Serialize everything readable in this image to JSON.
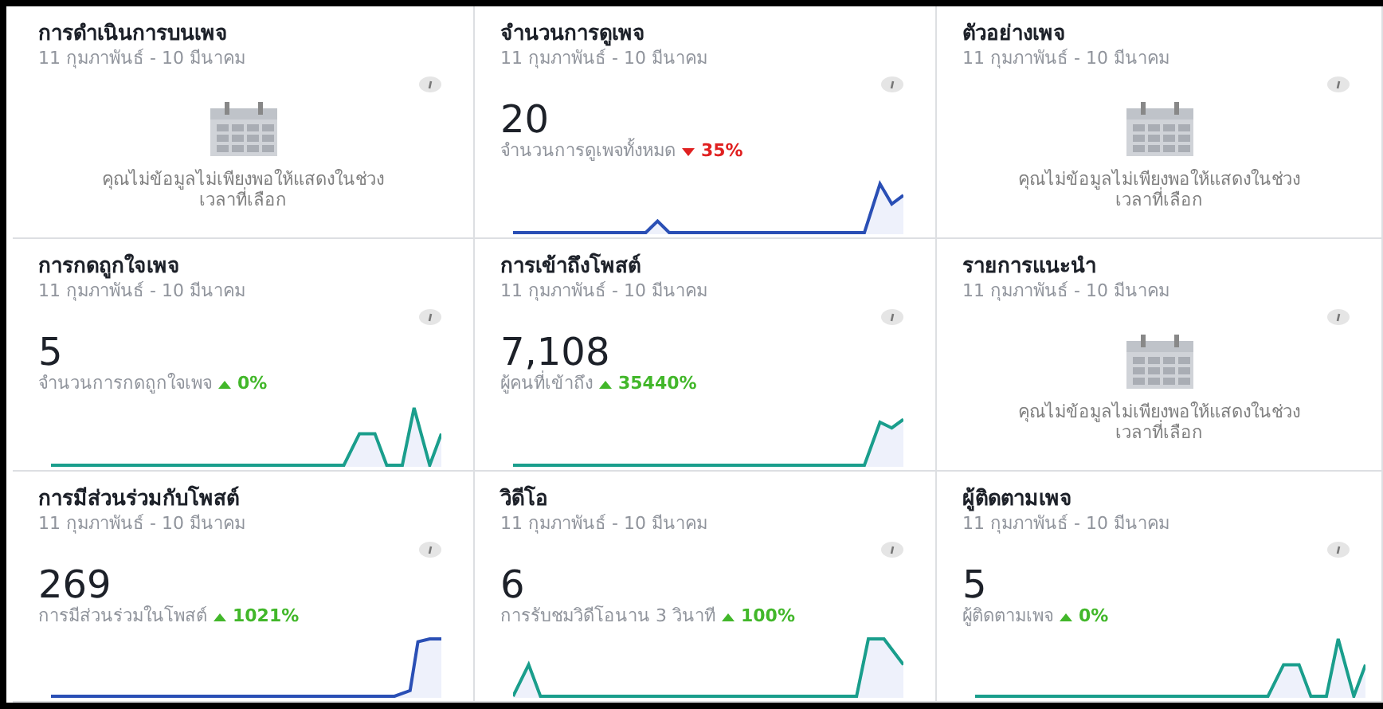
{
  "cards": [
    {
      "kind": "empty",
      "title": "การดำเนินการบนเพจ",
      "date_range": "11 กุมภาพันธ์ - 10 มีนาคม",
      "message": "คุณไม่ข้อมูลไม่เพียงพอให้แสดงในช่วงเวลาที่เลือก"
    },
    {
      "kind": "stat",
      "title": "จำนวนการดูเพจ",
      "date_range": "11 กุมภาพันธ์ - 10 มีนาคม",
      "value": "20",
      "caption": "จำนวนการดูเพจทั้งหมด",
      "rising": false,
      "change": "35%"
    },
    {
      "kind": "empty",
      "title": "ตัวอย่างเพจ",
      "date_range": "11 กุมภาพันธ์ - 10 มีนาคม",
      "message": "คุณไม่ข้อมูลไม่เพียงพอให้แสดงในช่วงเวลาที่เลือก"
    },
    {
      "kind": "stat",
      "title": "การกดถูกใจเพจ",
      "date_range": "11 กุมภาพันธ์ - 10 มีนาคม",
      "value": "5",
      "caption": "จำนวนการกดถูกใจเพจ",
      "rising": true,
      "change": "0%"
    },
    {
      "kind": "stat",
      "title": "การเข้าถึงโพสต์",
      "date_range": "11 กุมภาพันธ์ - 10 มีนาคม",
      "value": "7,108",
      "caption": "ผู้คนที่เข้าถึง",
      "rising": true,
      "change": "35440%"
    },
    {
      "kind": "empty",
      "title": "รายการแนะนำ",
      "date_range": "11 กุมภาพันธ์ - 10 มีนาคม",
      "message": "คุณไม่ข้อมูลไม่เพียงพอให้แสดงในช่วงเวลาที่เลือก"
    },
    {
      "kind": "stat",
      "title": "การมีส่วนร่วมกับโพสต์",
      "date_range": "11 กุมภาพันธ์ - 10 มีนาคม",
      "value": "269",
      "caption": "การมีส่วนร่วมในโพสต์",
      "rising": true,
      "change": "1021%"
    },
    {
      "kind": "stat",
      "title": "วิดีโอ",
      "date_range": "11 กุมภาพันธ์ - 10 มีนาคม",
      "value": "6",
      "caption": "การรับชมวิดีโอนาน 3 วินาที",
      "rising": true,
      "change": "100%"
    },
    {
      "kind": "stat",
      "title": "ผู้ติดตามเพจ",
      "date_range": "11 กุมภาพันธ์ - 10 มีนาคม",
      "value": "5",
      "caption": "ผู้ติดตามเพจ",
      "rising": true,
      "change": "0%"
    }
  ]
}
